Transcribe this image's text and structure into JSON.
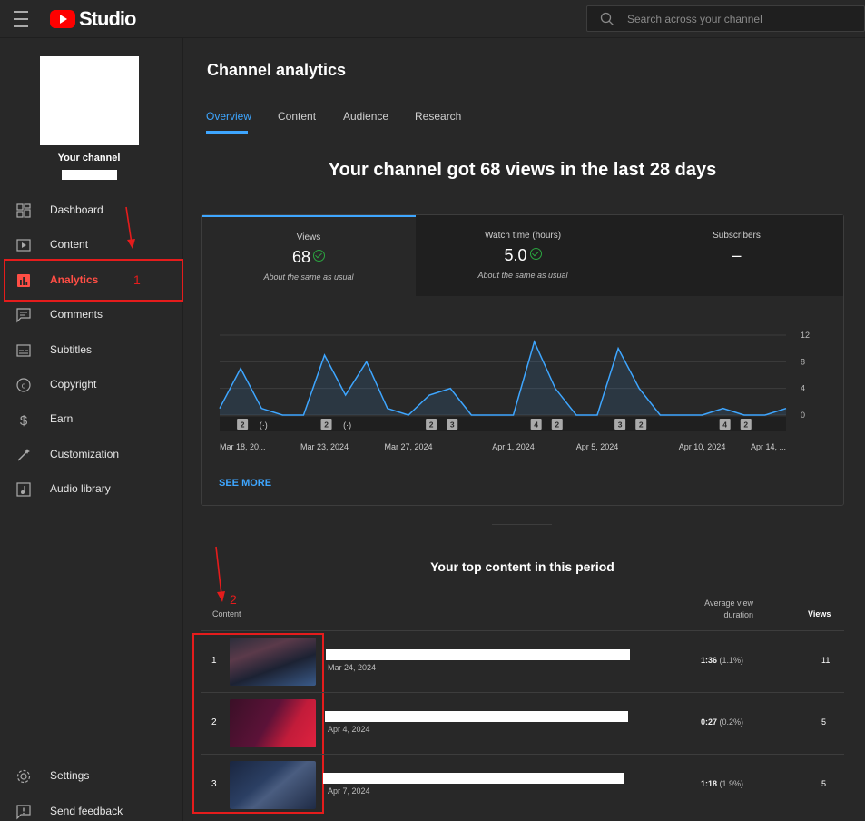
{
  "header": {
    "logo_text": "Studio",
    "search_placeholder": "Search across your channel"
  },
  "sidebar": {
    "channel_label": "Your channel",
    "items": [
      {
        "label": "Dashboard",
        "icon": "dashboard-icon"
      },
      {
        "label": "Content",
        "icon": "content-icon"
      },
      {
        "label": "Analytics",
        "icon": "analytics-icon",
        "active": true
      },
      {
        "label": "Comments",
        "icon": "comments-icon"
      },
      {
        "label": "Subtitles",
        "icon": "subtitles-icon"
      },
      {
        "label": "Copyright",
        "icon": "copyright-icon"
      },
      {
        "label": "Earn",
        "icon": "earn-icon"
      },
      {
        "label": "Customization",
        "icon": "customization-icon"
      },
      {
        "label": "Audio library",
        "icon": "audio-library-icon"
      }
    ],
    "bottom_items": [
      {
        "label": "Settings",
        "icon": "settings-icon"
      },
      {
        "label": "Send feedback",
        "icon": "feedback-icon"
      }
    ]
  },
  "annotations": {
    "marker_1": "1",
    "marker_2": "2"
  },
  "main": {
    "title": "Channel analytics",
    "tabs": [
      {
        "label": "Overview",
        "active": true
      },
      {
        "label": "Content"
      },
      {
        "label": "Audience"
      },
      {
        "label": "Research"
      }
    ],
    "headline": "Your channel got 68 views in the last 28 days",
    "metrics": [
      {
        "label": "Views",
        "value": "68",
        "check": true,
        "sub": "About the same as usual"
      },
      {
        "label": "Watch time (hours)",
        "value": "5.0",
        "check": true,
        "sub": "About the same as usual"
      },
      {
        "label": "Subscribers",
        "value": "–",
        "check": false,
        "sub": ""
      }
    ],
    "see_more": "SEE MORE",
    "top_content": {
      "title": "Your top content in this period",
      "col_content": "Content",
      "col_duration": "Average view duration",
      "col_views": "Views",
      "rows": [
        {
          "rank": "1",
          "date": "Mar 24, 2024",
          "duration": "1:36",
          "pct": "(1.1%)",
          "views": "11"
        },
        {
          "rank": "2",
          "date": "Apr 4, 2024",
          "duration": "0:27",
          "pct": "(0.2%)",
          "views": "5"
        },
        {
          "rank": "3",
          "date": "Apr 7, 2024",
          "duration": "1:18",
          "pct": "(1.9%)",
          "views": "5"
        }
      ]
    }
  },
  "colors": {
    "accent": "#3ea6ff",
    "active_nav": "#ff4e45",
    "annotation_red": "#e51c1c",
    "check_green": "#2ba640",
    "brand": "#ff0000"
  },
  "chart_data": {
    "type": "area",
    "series": [
      {
        "values": [
          1,
          7,
          1,
          0,
          0,
          9,
          3,
          8,
          1,
          0,
          3,
          4,
          0,
          0,
          0,
          11,
          4,
          0,
          0,
          10,
          4,
          0,
          0,
          0,
          1,
          0,
          0,
          1
        ]
      }
    ],
    "y_ticks": [
      "0",
      "4",
      "8",
      "12"
    ],
    "ylim": [
      0,
      12
    ],
    "x_tick_labels": [
      "Mar 18, 20...",
      "Mar 23, 2024",
      "Mar 27, 2024",
      "Apr 1, 2024",
      "Apr 5, 2024",
      "Apr 10, 2024",
      "Apr 14, ..."
    ],
    "x_tick_days": [
      0,
      5,
      9,
      14,
      18,
      23,
      27
    ],
    "markers": [
      {
        "day": 1,
        "label": "2"
      },
      {
        "day": 2,
        "label": "live"
      },
      {
        "day": 5,
        "label": "2"
      },
      {
        "day": 6,
        "label": "live"
      },
      {
        "day": 10,
        "label": "2"
      },
      {
        "day": 11,
        "label": "3"
      },
      {
        "day": 15,
        "label": "4"
      },
      {
        "day": 16,
        "label": "2"
      },
      {
        "day": 19,
        "label": "3"
      },
      {
        "day": 20,
        "label": "2"
      },
      {
        "day": 24,
        "label": "4"
      },
      {
        "day": 25,
        "label": "2"
      }
    ],
    "grid": true
  }
}
